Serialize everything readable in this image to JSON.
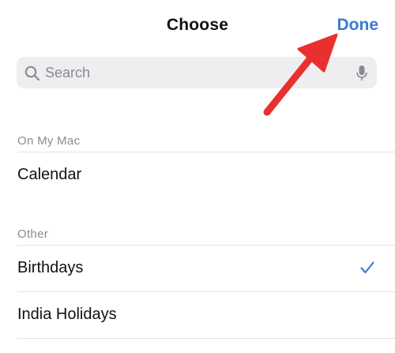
{
  "header": {
    "title": "Choose",
    "done_label": "Done"
  },
  "search": {
    "placeholder": "Search",
    "value": ""
  },
  "sections": [
    {
      "header": "On My Mac",
      "items": [
        {
          "label": "Calendar",
          "checked": false
        }
      ]
    },
    {
      "header": "Other",
      "items": [
        {
          "label": "Birthdays",
          "checked": true
        },
        {
          "label": "India Holidays",
          "checked": false
        }
      ]
    }
  ],
  "icons": {
    "search": "search-icon",
    "mic": "microphone-icon",
    "check": "checkmark-icon",
    "annotation": "red-arrow-annotation"
  },
  "colors": {
    "accent": "#3a7bd5",
    "annotation": "#e8312f",
    "secondary_text": "#8a8a8e",
    "search_bg": "#eeeef0"
  }
}
